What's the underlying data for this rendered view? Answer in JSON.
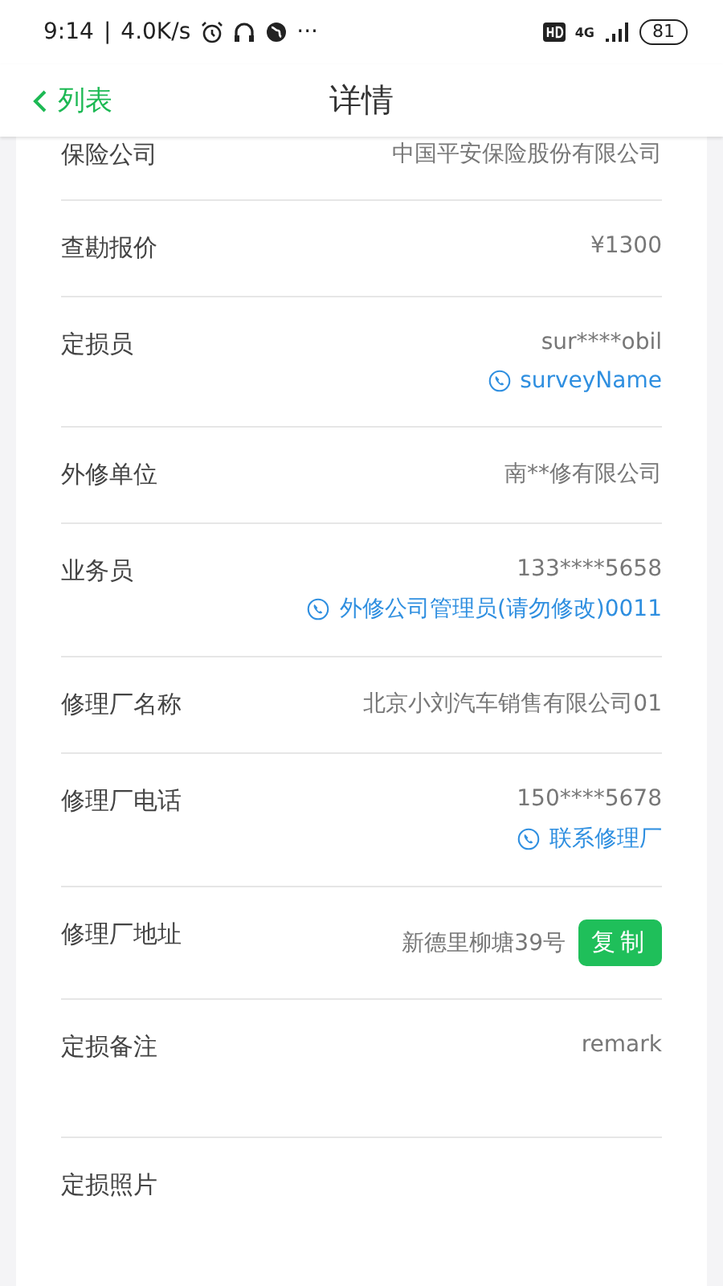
{
  "status_bar": {
    "time": "9:14",
    "separator": "|",
    "speed": "4.0K/s",
    "more": "···",
    "network": "4G",
    "battery": "81"
  },
  "nav": {
    "back": "列表",
    "title": "详情"
  },
  "rows": [
    {
      "kind": "plain",
      "label": "保险公司",
      "value": "中国平安保险股份有限公司"
    },
    {
      "kind": "plain",
      "label": "查勘报价",
      "value": "¥1300"
    },
    {
      "kind": "contact",
      "label": "定损员",
      "value": "sur****obil",
      "link": "surveyName"
    },
    {
      "kind": "plain",
      "label": "外修单位",
      "value": "南**修有限公司"
    },
    {
      "kind": "contact",
      "label": "业务员",
      "value": "133****5658",
      "link": "外修公司管理员(请勿修改)0011"
    },
    {
      "kind": "plain",
      "label": "修理厂名称",
      "value": "北京小刘汽车销售有限公司01"
    },
    {
      "kind": "contact",
      "label": "修理厂电话",
      "value": "150****5678",
      "link": "联系修理厂"
    },
    {
      "kind": "copy",
      "label": "修理厂地址",
      "value": "新德里柳塘39号",
      "button": "复制"
    },
    {
      "kind": "tall",
      "label": "定损备注",
      "value": "remark"
    },
    {
      "kind": "label",
      "label": "定损照片"
    }
  ]
}
